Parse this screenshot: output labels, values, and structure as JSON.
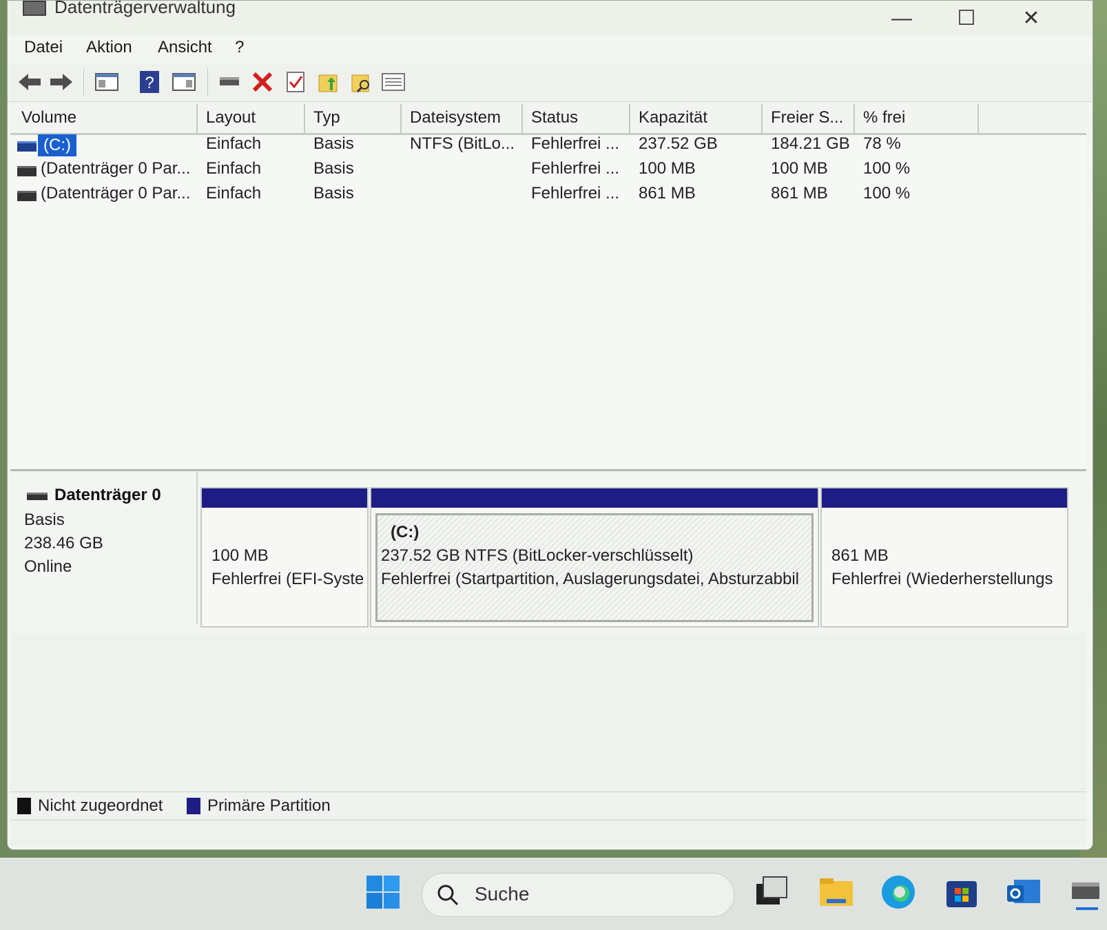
{
  "window": {
    "title": "Datenträgerverwaltung",
    "min": "—",
    "max": "☐",
    "close": "✕"
  },
  "menu": [
    "Datei",
    "Aktion",
    "Ansicht",
    "?"
  ],
  "toolbar_icons": [
    "back-icon",
    "forward-icon",
    "console-tree-icon",
    "help-icon",
    "properties-icon",
    "connect-icon",
    "delete-icon",
    "checkmark-icon",
    "folder-up-icon",
    "search-folder-icon",
    "list-view-icon"
  ],
  "volumes": {
    "headers": [
      "Volume",
      "Layout",
      "Typ",
      "Dateisystem",
      "Status",
      "Kapazität",
      "Freier S...",
      "% frei"
    ],
    "rows": [
      {
        "volume": "(C:)",
        "layout": "Einfach",
        "typ": "Basis",
        "fs": "NTFS (BitLo...",
        "status": "Fehlerfrei ...",
        "kap": "237.52 GB",
        "frei": "184.21 GB",
        "pct": "78 %"
      },
      {
        "volume": "(Datenträger 0 Par...",
        "layout": "Einfach",
        "typ": "Basis",
        "fs": "",
        "status": "Fehlerfrei ...",
        "kap": "100 MB",
        "frei": "100 MB",
        "pct": "100 %"
      },
      {
        "volume": "(Datenträger 0 Par...",
        "layout": "Einfach",
        "typ": "Basis",
        "fs": "",
        "status": "Fehlerfrei ...",
        "kap": "861 MB",
        "frei": "861 MB",
        "pct": "100 %"
      }
    ]
  },
  "disk": {
    "name": "Datenträger 0",
    "type": "Basis",
    "size": "238.46 GB",
    "state": "Online",
    "partitions": [
      {
        "title": "",
        "line1": "100 MB",
        "line2": "Fehlerfrei (EFI-Syste"
      },
      {
        "title": "(C:)",
        "line1": "237.52 GB NTFS (BitLocker-verschlüsselt)",
        "line2": "Fehlerfrei (Startpartition, Auslagerungsdatei, Absturzabbil"
      },
      {
        "title": "",
        "line1": "861 MB",
        "line2": "Fehlerfrei (Wiederherstellungs"
      }
    ]
  },
  "legend": [
    {
      "label": "Nicht zugeordnet",
      "color": "#111111"
    },
    {
      "label": "Primäre Partition",
      "color": "#1d1d85"
    }
  ],
  "taskbar": {
    "search_placeholder": "Suche",
    "icons": [
      "windows-start-icon",
      "search-icon",
      "task-view-icon",
      "file-explorer-icon",
      "edge-icon",
      "store-icon",
      "outlook-icon",
      "disk-management-icon"
    ]
  }
}
